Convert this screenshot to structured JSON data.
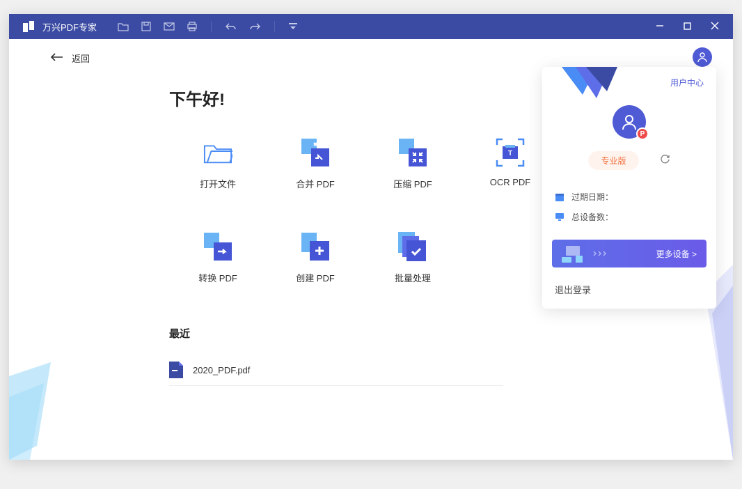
{
  "app": {
    "title": "万兴PDF专家"
  },
  "back": {
    "label": "返回"
  },
  "greeting": "下午好!",
  "actions": [
    {
      "label": "打开文件"
    },
    {
      "label": "合并 PDF"
    },
    {
      "label": "压缩 PDF"
    },
    {
      "label": "OCR PDF"
    },
    {
      "label": "转换 PDF"
    },
    {
      "label": "创建 PDF"
    },
    {
      "label": "批量处理"
    }
  ],
  "recent": {
    "title": "最近",
    "items": [
      {
        "name": "2020_PDF.pdf"
      }
    ]
  },
  "user_panel": {
    "user_center": "用户中心",
    "pro_label": "专业版",
    "badge": "P",
    "expire_label": "过期日期：",
    "devices_label": "总设备数：",
    "more_devices": "更多设备 >",
    "logout": "退出登录"
  }
}
